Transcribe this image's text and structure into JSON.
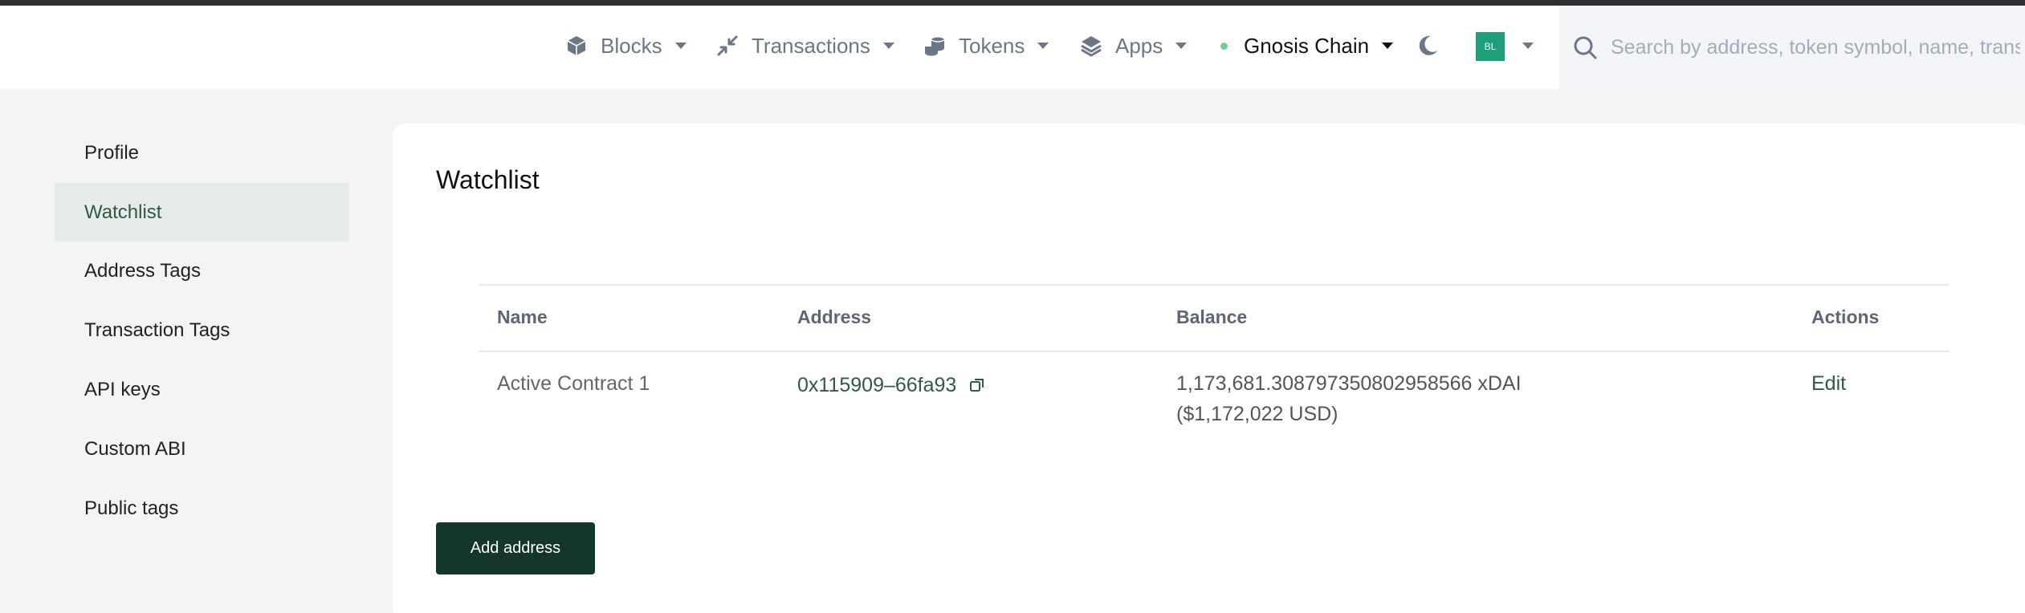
{
  "header": {
    "nav": [
      {
        "label": "Blocks",
        "icon": "cube-icon"
      },
      {
        "label": "Transactions",
        "icon": "arrows-icon"
      },
      {
        "label": "Tokens",
        "icon": "coins-icon"
      },
      {
        "label": "Apps",
        "icon": "layers-icon"
      }
    ],
    "chain": {
      "label": "Gnosis Chain",
      "status_color": "#6fcf97"
    },
    "theme_icon": "moon-icon",
    "avatar_text": "BL",
    "search_placeholder": "Search by address, token symbol, name, transaction hash, or block number"
  },
  "sidebar": {
    "items": [
      {
        "label": "Profile",
        "active": false
      },
      {
        "label": "Watchlist",
        "active": true
      },
      {
        "label": "Address Tags",
        "active": false
      },
      {
        "label": "Transaction Tags",
        "active": false
      },
      {
        "label": "API keys",
        "active": false
      },
      {
        "label": "Custom ABI",
        "active": false
      },
      {
        "label": "Public tags",
        "active": false
      }
    ]
  },
  "main": {
    "title": "Watchlist",
    "table": {
      "headers": [
        "Name",
        "Address",
        "Balance",
        "Actions"
      ],
      "rows": [
        {
          "name": "Active Contract 1",
          "address": "0x115909–66fa93",
          "balance": "1,173,681.308797350802958566 xDAI",
          "balance_usd": "($1,172,022 USD)",
          "action": "Edit"
        }
      ]
    },
    "add_button": "Add address"
  },
  "colors": {
    "accent": "#2f5a45",
    "button": "#15372a",
    "avatar": "#1f9e7c"
  }
}
